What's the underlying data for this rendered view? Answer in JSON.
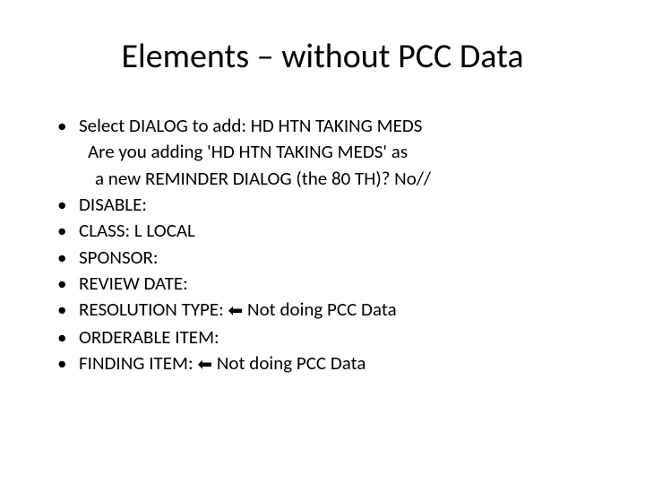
{
  "title": "Elements – without PCC Data",
  "items": [
    {
      "lead": "Select DIALOG to add: HD HTN TAKING MEDS",
      "cont1": "Are you adding 'HD HTN TAKING MEDS' as",
      "cont2": "a new REMINDER DIALOG (the 80 TH)? No//"
    },
    {
      "label": "DISABLE:"
    },
    {
      "label": "CLASS: L  LOCAL"
    },
    {
      "label": "SPONSOR:"
    },
    {
      "label": "REVIEW DATE:"
    },
    {
      "label": "RESOLUTION TYPE:  ",
      "note": " Not doing PCC Data",
      "arrow": true
    },
    {
      "label": "ORDERABLE ITEM:"
    },
    {
      "label": "FINDING ITEM:  ",
      "note": " Not doing PCC Data",
      "arrow": true
    }
  ],
  "bulletChar": "•",
  "arrowChar": "⬅"
}
